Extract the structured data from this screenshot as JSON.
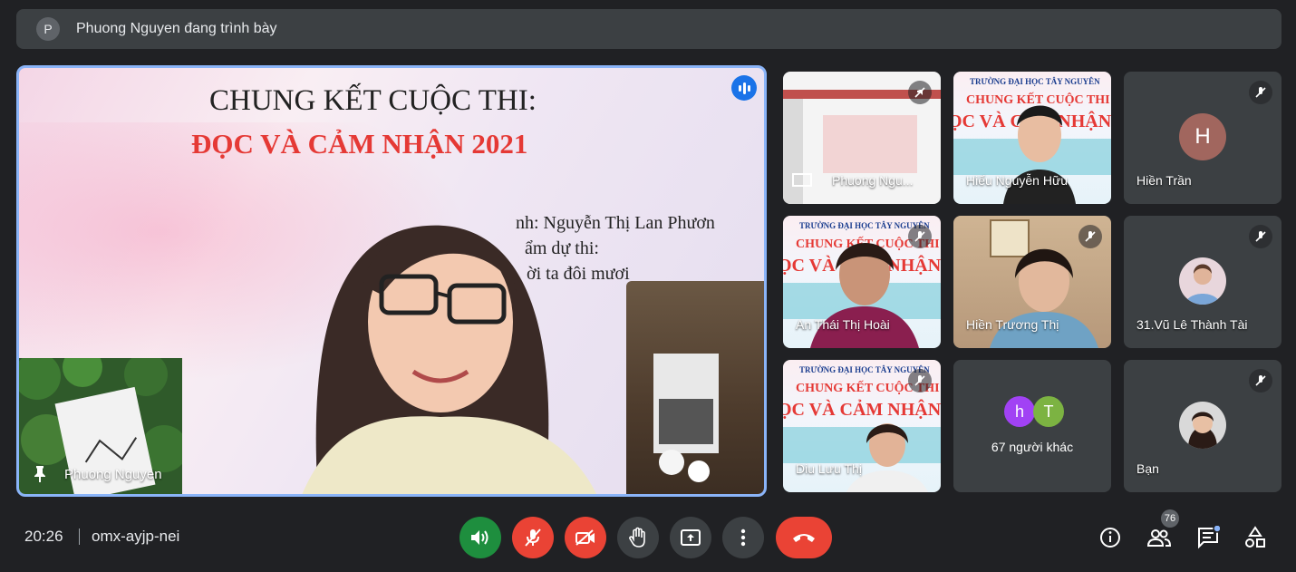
{
  "banner": {
    "avatar_initial": "P",
    "text": "Phuong Nguyen đang trình bày"
  },
  "main": {
    "title_line1": "CHUNG KẾT CUỘC THI:",
    "title_line2": "ĐỌC VÀ CẢM NHẬN 2021",
    "slide_lines": [
      "nh: Nguyễn Thị Lan Phươn",
      "ẩm dự thi:",
      "ời ta đôi mươi"
    ],
    "speaker_name": "Phuong Nguyen",
    "accent": "#8ab4f8"
  },
  "tiles": [
    {
      "name": "Phuong Ngu...",
      "muted": true,
      "kind": "screen"
    },
    {
      "name": "Hiếu Nguyễn Hữu",
      "muted": false,
      "kind": "video"
    },
    {
      "name": "Hiền Trần",
      "muted": true,
      "kind": "avatar",
      "initial": "H",
      "avatar_color": "#a1665e"
    },
    {
      "name": "An Thái Thị Hoài",
      "muted": true,
      "kind": "video"
    },
    {
      "name": "Hiền Trương Thị",
      "muted": true,
      "kind": "video"
    },
    {
      "name": "31.Vũ Lê Thành Tài",
      "muted": true,
      "kind": "photo-avatar"
    },
    {
      "name": "Diu Lưu Thị",
      "muted": true,
      "kind": "video"
    },
    {
      "name": "67 người khác",
      "kind": "group",
      "initials": [
        "h",
        "T"
      ]
    },
    {
      "name": "Bạn",
      "muted": true,
      "kind": "photo-avatar"
    }
  ],
  "tile_banner": {
    "school": "TRƯỜNG ĐẠI HỌC TÂY NGUYÊN",
    "line1": "CHUNG KẾT CUỘC THI",
    "line2": "ỌC VÀ CẢM NHẬN 20"
  },
  "bottom": {
    "time": "20:26",
    "meeting_code": "omx-ayjp-nei",
    "participant_count": "76",
    "colors": {
      "red": "#ea4335",
      "green": "#1e8e3e",
      "gray": "#3c4043"
    }
  }
}
